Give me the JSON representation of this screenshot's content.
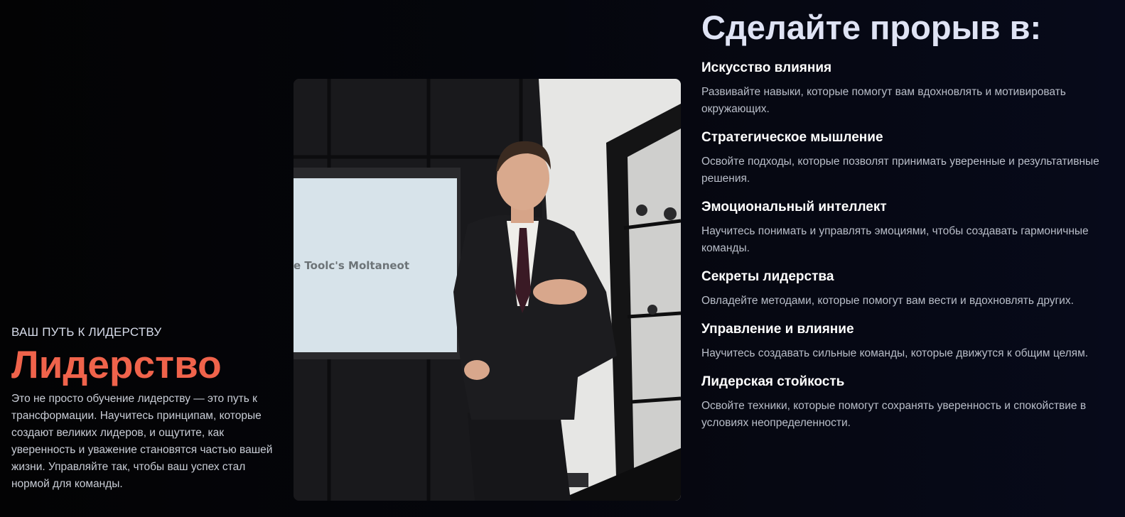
{
  "hero": {
    "eyebrow": "ВАШ ПУТЬ К ЛИДЕРСТВУ",
    "title": "Лидерство",
    "text": "Это не просто обучение лидерству — это путь к трансформации. Научитесь принципам, которые создают великих лидеров, и ощутите, как уверенность и уважение становятся частью вашей жизни. Управляйте так, чтобы ваш успех стал нормой для команды."
  },
  "photo": {
    "slide_text": "e Toolc's Moltaneot"
  },
  "breakthrough": {
    "title": "Сделайте прорыв в:",
    "features": [
      {
        "title": "Искусство влияния",
        "text": "Развивайте навыки, которые помогут вам вдохновлять и мотивировать окружающих."
      },
      {
        "title": "Стратегическое мышление",
        "text": "Освойте подходы, которые позволят принимать уверенные и результативные решения."
      },
      {
        "title": "Эмоциональный интеллект",
        "text": "Научитесь понимать и управлять эмоциями, чтобы создавать гармоничные команды."
      },
      {
        "title": "Секреты лидерства",
        "text": "Овладейте методами, которые помогут вам вести и вдохновлять других."
      },
      {
        "title": "Управление и влияние",
        "text": "Научитесь создавать сильные команды, которые движутся к общим целям."
      },
      {
        "title": "Лидерская стойкость",
        "text": "Освойте техники, которые помогут сохранять уверенность и спокойствие в условиях неопределенности."
      }
    ]
  }
}
